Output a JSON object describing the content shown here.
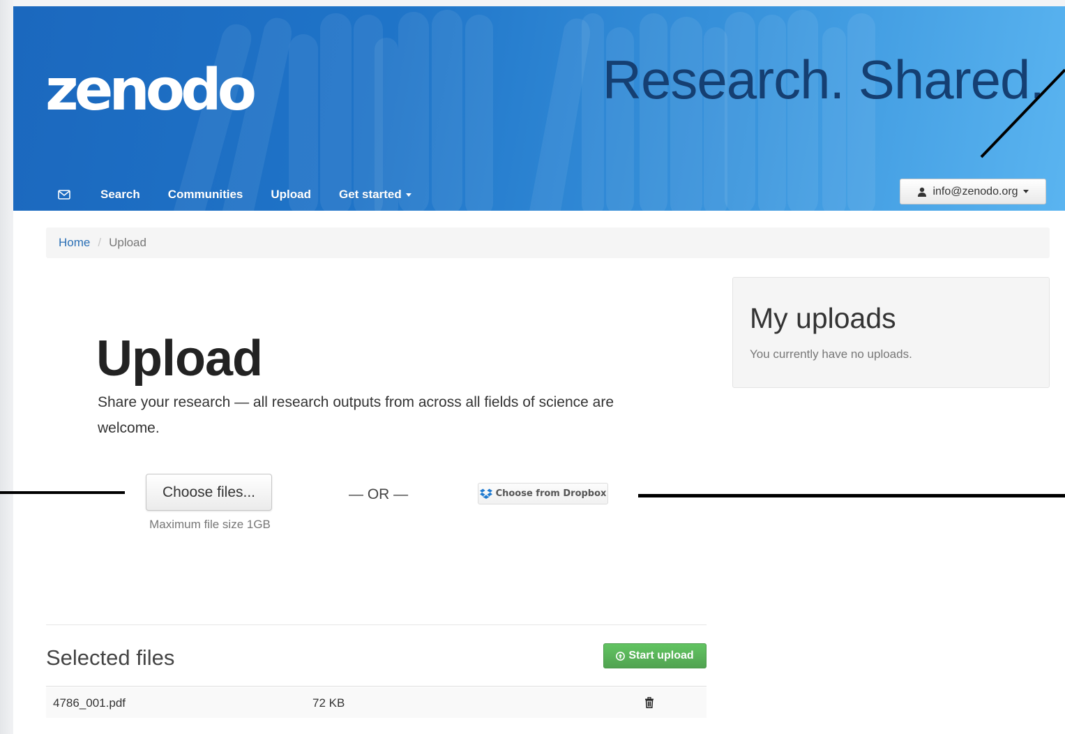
{
  "header": {
    "logo": "zenodo",
    "tagline": "Research. Shared.",
    "nav": {
      "mail_icon": "envelope-icon",
      "items": [
        "Search",
        "Communities",
        "Upload",
        "Get started"
      ]
    },
    "user_menu": {
      "email": "info@zenodo.org",
      "icon": "user-icon"
    }
  },
  "breadcrumb": {
    "home": "Home",
    "separator": "/",
    "current": "Upload"
  },
  "upload": {
    "title": "Upload",
    "description": "Share your research — all research outputs from across all fields of science are welcome.",
    "choose_files": "Choose files...",
    "max_size": "Maximum file size 1GB",
    "or": "— OR —",
    "dropbox": "Choose from Dropbox"
  },
  "my_uploads": {
    "title": "My uploads",
    "text": "You currently have no uploads."
  },
  "selected_files": {
    "title": "Selected files",
    "start_upload": "Start upload",
    "files": [
      {
        "name": "4786_001.pdf",
        "size": "72 KB"
      }
    ]
  },
  "colors": {
    "header_blue": "#1f74c8",
    "link_blue": "#2a6fb5",
    "success_green": "#51a351"
  }
}
